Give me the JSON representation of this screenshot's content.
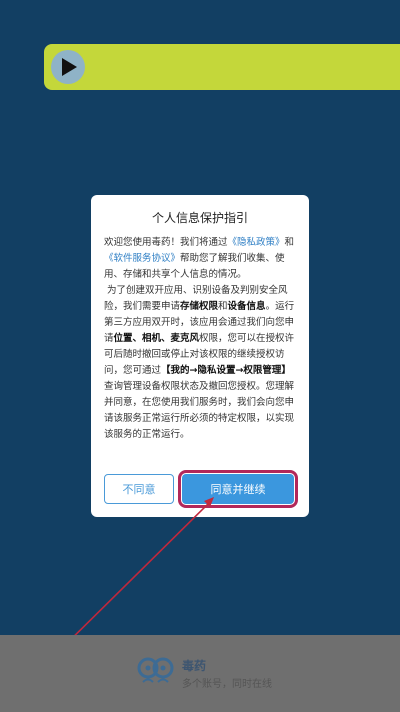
{
  "dialog": {
    "title": "个人信息保护指引",
    "p1_a": "欢迎您使用毒药！我们将通过",
    "p1_link1": "《隐私政策》",
    "p1_b": "和",
    "p1_link2": "《软件服务协议》",
    "p1_c": "帮助您了解我们收集、使用、存储和共享个人信息的情况。",
    "p2_a": "为了创建双开应用、识别设备及判别安全风险，我们需要申请",
    "p2_b1": "存储权限",
    "p2_b": "和",
    "p2_b2": "设备信息",
    "p2_c": "。运行第三方应用双开时，该应用会通过我们向您申请",
    "p2_d1": "位置、相机、麦克风",
    "p2_d": "权限，您可以在授权许可后随时撤回或停止对该权限的继续授权访问，您可通过",
    "p2_e1": "【我的→隐私设置→权限管理】",
    "p2_e": "查询管理设备权限状态及撤回您授权。您理解并同意，在您使用我们服务时，我们会向您申请该服务正常运行所必须的特定权限，以实现该服务的正常运行。",
    "decline_label": "不同意",
    "accept_label": "同意并继续"
  },
  "footer": {
    "app_name": "毒药",
    "slogan": "多个账号，同时在线"
  },
  "icons": {
    "play": "play-icon",
    "logo": "app-logo-icon"
  },
  "colors": {
    "background": "#123f63",
    "banner": "#c4d73a",
    "accent": "#3b97de",
    "highlight": "#b2285a"
  }
}
